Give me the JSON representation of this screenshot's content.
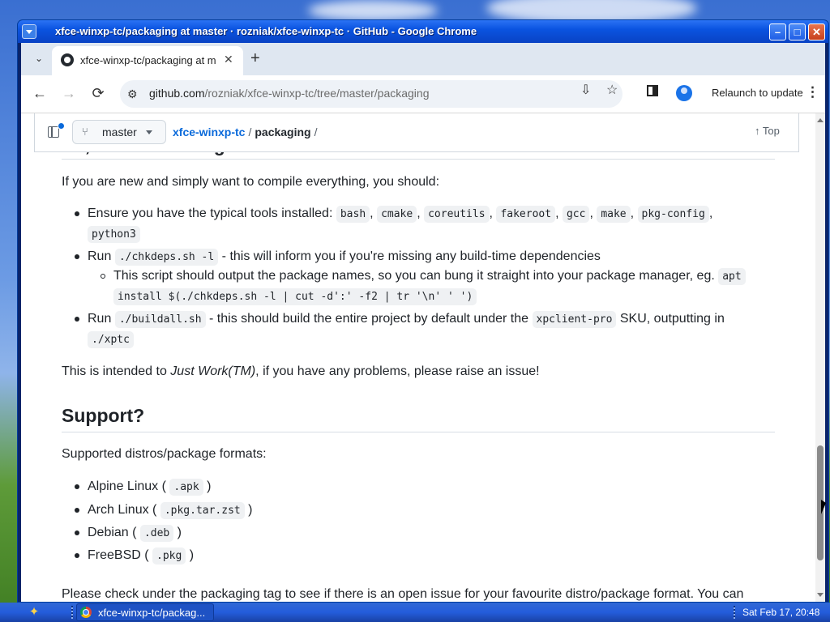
{
  "window": {
    "title": "xfce-winxp-tc/packaging at master · rozniak/xfce-winxp-tc · GitHub - Google Chrome",
    "minimize": "–",
    "maximize": "□",
    "close": "✕"
  },
  "browser": {
    "tab_title": "xfce-winxp-tc/packaging at m",
    "tab_close": "✕",
    "new_tab": "+",
    "url_host": "github.com",
    "url_path": "/rozniak/xfce-winxp-tc/tree/master/packaging",
    "relaunch_label": "Relaunch to update",
    "back": "←",
    "forward": "→",
    "reload": "⟳",
    "kebab": "⋮",
    "dropdown": "⌄"
  },
  "repo_bar": {
    "branch": "master",
    "repo": "xfce-winxp-tc",
    "sep": "/",
    "dir": "packaging",
    "trailing_sep": "/",
    "top_label": "Top"
  },
  "readme": {
    "heading_tldr": "TL;DR on Building",
    "intro": "If you are new and simply want to compile everything, you should:",
    "tools_prefix": "Ensure you have the typical tools installed:",
    "tools": [
      "bash",
      "cmake",
      "coreutils",
      "fakeroot",
      "gcc",
      "make",
      "pkg-config",
      "python3"
    ],
    "run1_prefix": "Run",
    "run1_code": "./chkdeps.sh -l",
    "run1_text": "- this will inform you if you're missing any build-time dependencies",
    "sub_text": "This script should output the package names, so you can bung it straight into your package manager, eg.",
    "sub_code_a": "apt",
    "sub_code_b": "install $(./chkdeps.sh -l | cut -d':' -f2 | tr '\\n' ' ')",
    "run2_prefix": "Run",
    "run2_code": "./buildall.sh",
    "run2_text": "- this should build the entire project by default under the",
    "run2_code2": "xpclient-pro",
    "run2_text2": "SKU, outputting in",
    "run2_code3": "./xptc",
    "intended_a": "This is intended to ",
    "intended_em": "Just Work(TM)",
    "intended_b": ", if you have any problems, please raise an issue!",
    "heading_support": "Support?",
    "supported": "Supported distros/package formats:",
    "distros": [
      {
        "name": "Alpine Linux",
        "fmt": ".apk"
      },
      {
        "name": "Arch Linux",
        "fmt": ".pkg.tar.zst"
      },
      {
        "name": "Debian",
        "fmt": ".deb"
      },
      {
        "name": "FreeBSD",
        "fmt": ".pkg"
      }
    ],
    "cut_line": "Please check under the packaging tag to see if there is an open issue for your favourite distro/package format. You can"
  },
  "taskbar": {
    "task_label": "xfce-winxp-tc/packag...",
    "clock": "Sat Feb 17, 20:48"
  }
}
